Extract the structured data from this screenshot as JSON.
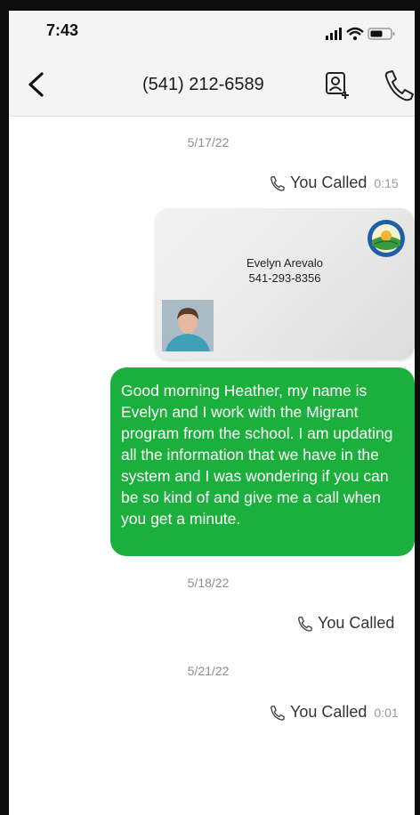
{
  "status_bar": {
    "time": "7:43",
    "icons": [
      "signal-icon",
      "wifi-icon",
      "battery-icon"
    ]
  },
  "header": {
    "title": "(541) 212-6589",
    "back_icon": "chevron-left-icon",
    "contact_icon": "add-contact-icon",
    "call_icon": "phone-icon"
  },
  "thread": [
    {
      "kind": "date",
      "text": "5/17/22"
    },
    {
      "kind": "call",
      "label": "You Called",
      "duration": "0:15"
    },
    {
      "kind": "contact_card",
      "name": "Evelyn Arevalo",
      "phone": "541-293-8356"
    },
    {
      "kind": "message",
      "direction": "outgoing",
      "text": "Good morning Heather, my name is Evelyn and I work with the Migrant program from the school. I am updating all the information that we have in the system and I was wondering if you can be so kind of and give me a call when you get a minute."
    },
    {
      "kind": "date",
      "text": "5/18/22"
    },
    {
      "kind": "call",
      "label": "You Called",
      "duration": ""
    },
    {
      "kind": "date",
      "text": "5/21/22"
    },
    {
      "kind": "call",
      "label": "You Called",
      "duration": "0:01"
    }
  ],
  "colors": {
    "outgoing_bubble": "#1bb03c",
    "outgoing_text": "#ffffff",
    "date_text": "#8e8e8e",
    "header_bg": "#f4f4f4"
  }
}
